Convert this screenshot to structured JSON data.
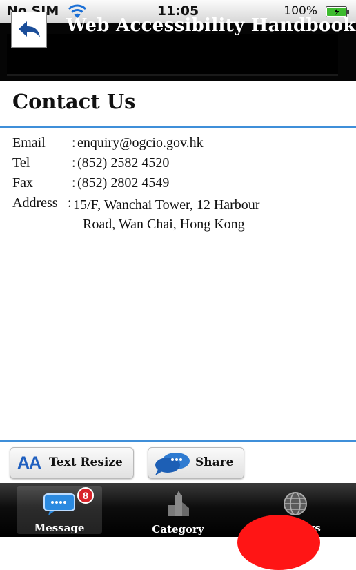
{
  "status_bar": {
    "carrier": "No SIM",
    "time": "11:05",
    "battery": "100%"
  },
  "title_bar": {
    "back_icon": "back-arrow-icon",
    "title": "Web Accessibility Handbook"
  },
  "page": {
    "title": "Contact Us"
  },
  "contact": {
    "email_label": "Email",
    "email_value": "enquiry@ogcio.gov.hk",
    "tel_label": "Tel",
    "tel_value": "(852) 2582 4520",
    "fax_label": "Fax",
    "fax_value": "(852) 2802 4549",
    "address_label": "Address",
    "address_line1": "15/F, Wanchai Tower, 12 Harbour",
    "address_line2": "Road, Wan Chai, Hong Kong",
    "separator": ":"
  },
  "actions": {
    "text_resize": "Text Resize",
    "text_resize_icon_text": "AA",
    "share": "Share"
  },
  "tabs": [
    {
      "label": "Message",
      "icon": "message-icon",
      "badge": "8",
      "active": true
    },
    {
      "label": "Category",
      "icon": "category-icon"
    },
    {
      "label": "Settings",
      "icon": "globe-icon"
    }
  ],
  "colors": {
    "accent_blue": "#3f8fd9",
    "badge_red": "#d8232a",
    "title_bg": "#000000"
  }
}
